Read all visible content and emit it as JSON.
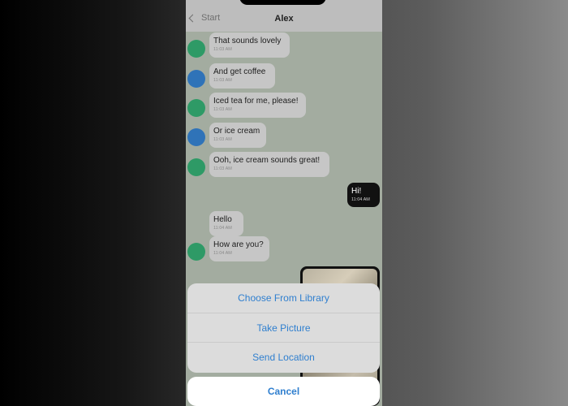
{
  "header": {
    "back_label": "Start",
    "title": "Alex"
  },
  "messages": [
    {
      "text": "That sounds lovely",
      "time": "11:03 AM",
      "avatar_color": "#2e9a66"
    },
    {
      "text": "And get coffee",
      "time": "11:03 AM",
      "avatar_color": "#2f73b8"
    },
    {
      "text": "Iced tea for me, please!",
      "time": "11:03 AM",
      "avatar_color": "#2e9a66"
    },
    {
      "text": "Or ice cream",
      "time": "11:03 AM",
      "avatar_color": "#2f73b8"
    },
    {
      "text": "Ooh, ice cream sounds great!",
      "time": "11:03 AM",
      "avatar_color": "#2e9a66"
    },
    {
      "text": "Hi!",
      "time": "11:04 AM",
      "sent": true
    },
    {
      "text": "Hello",
      "time": "11:04 AM"
    },
    {
      "text": "How are you?",
      "time": "11:04 AM",
      "avatar_color": "#2e9a66"
    }
  ],
  "action_sheet": {
    "options": [
      "Choose From Library",
      "Take Picture",
      "Send Location"
    ],
    "cancel_label": "Cancel"
  },
  "colors": {
    "accent": "#2f7fcf",
    "chat_background": "#a3aca0"
  }
}
